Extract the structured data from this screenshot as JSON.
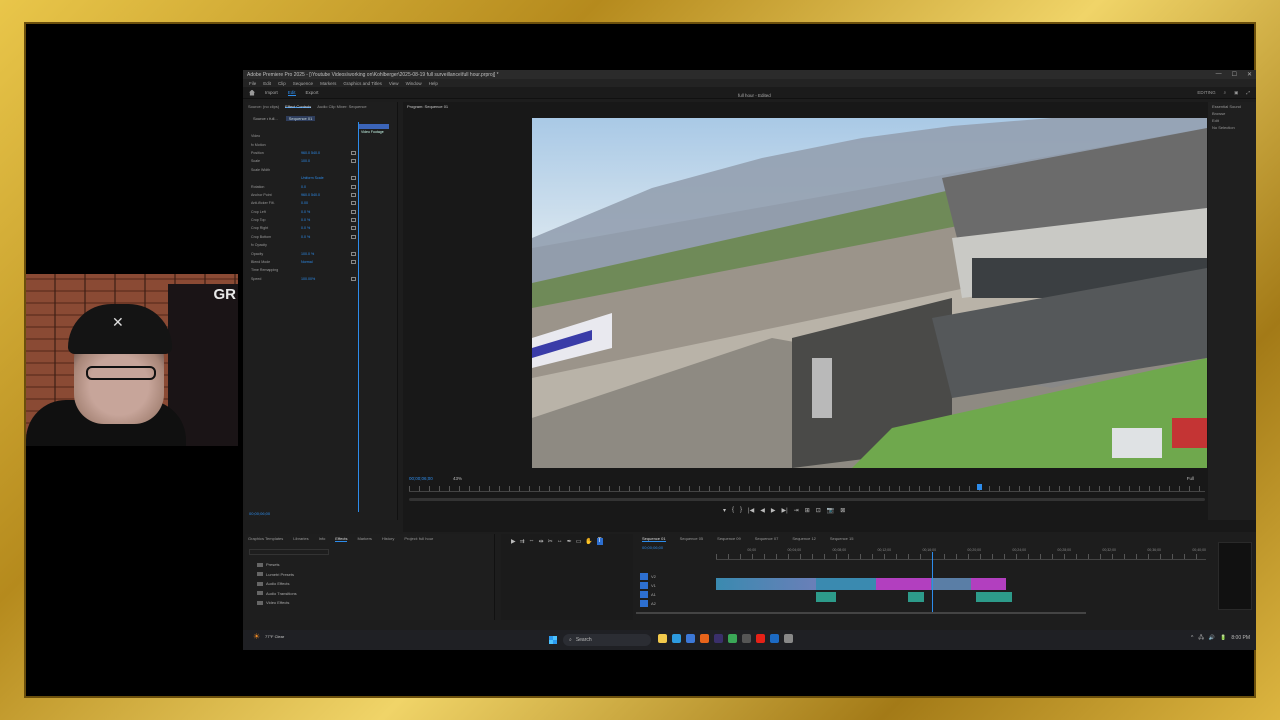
{
  "window": {
    "title": "Adobe Premiere Pro 2025 - [\\Youtube Videos\\working on\\Kohlberger\\2025-08-19 full surveillance\\full hour.prproj] *",
    "controls": [
      "—",
      "☐",
      "✕"
    ]
  },
  "menu": [
    "File",
    "Edit",
    "Clip",
    "Sequence",
    "Markers",
    "Graphics and Titles",
    "View",
    "Window",
    "Help"
  ],
  "workspace": {
    "tabs": [
      "Import",
      "Edit",
      "Export"
    ],
    "active": "Edit",
    "center_title": "full hour - Edited",
    "right": [
      "EDITING",
      "⌕",
      "▣",
      "⤢"
    ]
  },
  "effect_controls": {
    "tabs": [
      "Source: (no clips)",
      "Effect Controls",
      "Audio Clip Mixer: Sequence"
    ],
    "source_label": "Source • full...",
    "sequence_label": "Sequence 01",
    "clip_label": "Video Footage",
    "rows": [
      {
        "label": "Video",
        "value": ""
      },
      {
        "label": "fx Motion",
        "value": ""
      },
      {
        "label": "Position",
        "value": "960.0  540.0"
      },
      {
        "label": "Scale",
        "value": "100.0"
      },
      {
        "label": "Scale Width",
        "value": ""
      },
      {
        "label": "",
        "value": "Uniform Scale"
      },
      {
        "label": "Rotation",
        "value": "0.0"
      },
      {
        "label": "Anchor Point",
        "value": "960.0  540.0"
      },
      {
        "label": "Anti-flicker Filt.",
        "value": "0.00"
      },
      {
        "label": "Crop Left",
        "value": "0.0 %"
      },
      {
        "label": "Crop Top",
        "value": "0.0 %"
      },
      {
        "label": "Crop Right",
        "value": "0.0 %"
      },
      {
        "label": "Crop Bottom",
        "value": "0.0 %"
      },
      {
        "label": "fx Opacity",
        "value": ""
      },
      {
        "label": "Opacity",
        "value": "100.0 %"
      },
      {
        "label": "Blend Mode",
        "value": "Normal"
      },
      {
        "label": "Time Remapping",
        "value": ""
      },
      {
        "label": "Speed",
        "value": "100.00%"
      }
    ],
    "footer_timecode": "00;00;06;00"
  },
  "program_monitor": {
    "title": "Program: Sequence 01",
    "timecode": "00;00;06;00",
    "zoom": "43%",
    "quality": "Full",
    "duration": "00;07;11;01",
    "playhead_fraction": 0.713,
    "transport": [
      "▾",
      "{",
      "}",
      "|◀",
      "◀",
      "▶",
      "▶|",
      "⇥",
      "⊞",
      "⊡",
      "📷",
      "⊠"
    ]
  },
  "right_panel": {
    "items": [
      "Essential Sound",
      "Browse",
      "Edit",
      "No Selection"
    ]
  },
  "project_panel": {
    "tabs": [
      "Graphics Templates",
      "Libraries",
      "Info",
      "Effects",
      "Markers",
      "History",
      "Project: full hour"
    ],
    "active": "Effects",
    "tree": [
      "Presets",
      "Lumetri Presets",
      "Audio Effects",
      "Audio Transitions",
      "Video Effects"
    ]
  },
  "tools": [
    "▶",
    "⇉",
    "⇔",
    "⇹",
    "✂",
    "↔",
    "✒",
    "▭",
    "✋",
    "T"
  ],
  "timeline": {
    "tabs": [
      "Sequence 01",
      "Sequence 05",
      "Sequence 09",
      "Sequence 07",
      "Sequence 12",
      "Sequence 15"
    ],
    "active": "Sequence 01",
    "timecode": "00;00;06;00",
    "ticks": [
      "",
      "00;00",
      "00;04;00",
      "00;08;00",
      "00;12;00",
      "00;16;00",
      "00;20;00",
      "00;24;00",
      "00;28;00",
      "00;32;00",
      "00;36;00",
      "00;40;00"
    ],
    "tracks": [
      "V2",
      "V1",
      "A1",
      "A2"
    ],
    "playhead_fraction": 0.44
  },
  "taskbar": {
    "weather": "77°F Clear",
    "search_placeholder": "Search",
    "tray": [
      "^",
      "🖧",
      "🔊",
      "🔋",
      "8:00 PM"
    ]
  },
  "colors": {
    "accent": "#2d8ceb",
    "frame": "#caa22a",
    "clip_video": "#3a8ab0",
    "clip_magenta": "#b23fbf",
    "clip_audio": "#2d9b8a"
  }
}
